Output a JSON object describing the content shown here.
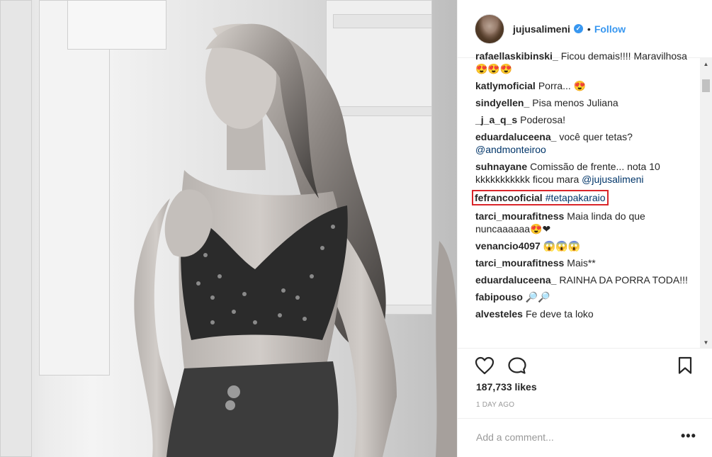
{
  "post": {
    "username": "jujusalimeni",
    "verified_mark": "✓",
    "separator": "•",
    "follow_label": "Follow",
    "likes": "187,733 likes",
    "time": "1 DAY AGO",
    "add_comment_placeholder": "Add a comment...",
    "more_options": "•••"
  },
  "comments": [
    {
      "user": "rafaellaskibinski_",
      "text": "Ficou demais!!!! Maravilhosa 😍😍😍"
    },
    {
      "user": "katlymoficial",
      "text": "Porra... 😍"
    },
    {
      "user": "sindyellen_",
      "text": "Pisa menos Juliana"
    },
    {
      "user": "_j_a_q_s",
      "text": "Poderosa!"
    },
    {
      "user": "eduardaluceena_",
      "text": "você quer tetas?",
      "mention": "@andmonteiroo"
    },
    {
      "user": "suhnayane",
      "text": "Comissão de frente... nota 10 kkkkkkkkkkk ficou mara",
      "mention": "@jujusalimeni"
    },
    {
      "user": "fefrancooficial",
      "tag": "#tetapakaraio"
    },
    {
      "user": "tarci_mourafitness",
      "text": "Maia linda do que nuncaaaaaa😍❤"
    },
    {
      "user": "venancio4097",
      "text": "😱😱😱"
    },
    {
      "user": "tarci_mourafitness",
      "text": "Mais**"
    },
    {
      "user": "eduardaluceena_",
      "text": "RAINHA DA PORRA TODA!!!"
    },
    {
      "user": "fabipouso",
      "text": "🔎🔎"
    },
    {
      "user": "alvesteles",
      "text": "Fe deve ta loko"
    }
  ],
  "scrollbar": {
    "up": "▲",
    "down": "▼"
  },
  "icons": {
    "like": "heart-icon",
    "comment": "comment-bubble-icon",
    "save": "bookmark-icon"
  },
  "colors": {
    "link": "#3897f0",
    "mention": "#003569",
    "highlight_border": "#d9262b",
    "meta_grey": "#999999"
  }
}
